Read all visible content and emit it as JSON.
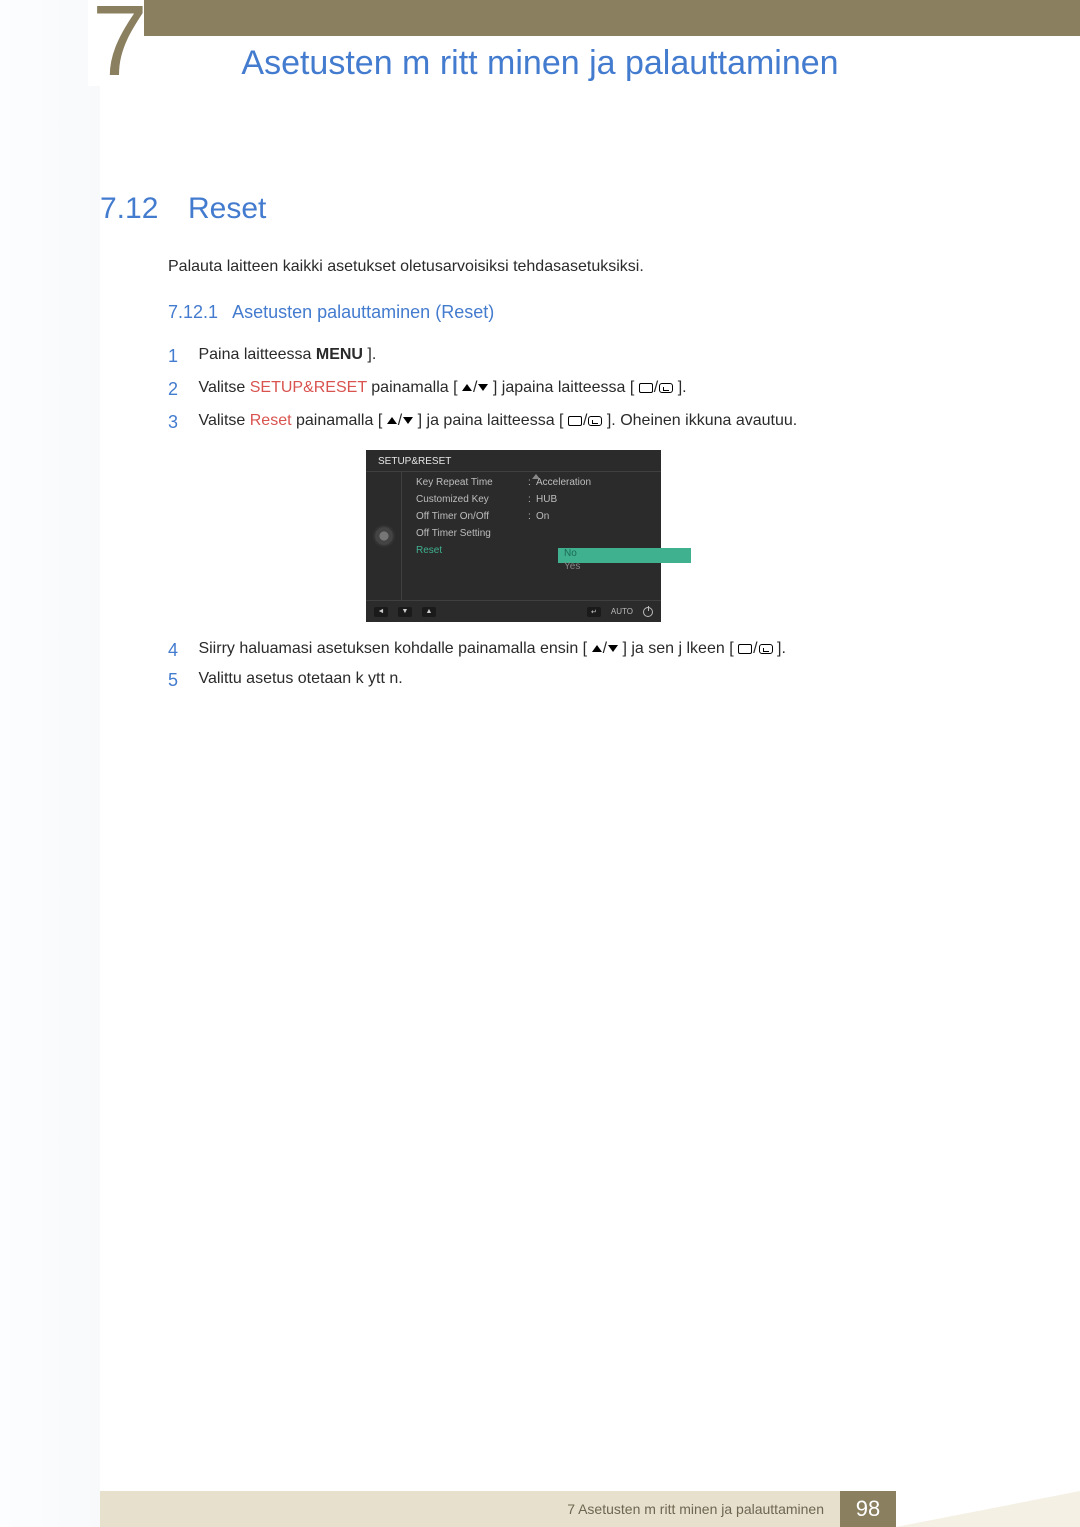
{
  "header": {
    "chapter": "7",
    "title": "Asetusten m  ritt minen ja palauttaminen"
  },
  "section": {
    "num": "7.12",
    "title": "Reset"
  },
  "intro": "Palauta laitteen kaikki asetukset oletusarvoisiksi tehdasasetuksiksi.",
  "subsection": {
    "num": "7.12.1",
    "title": "Asetusten palauttaminen (Reset)"
  },
  "steps": {
    "s1": {
      "num": "1",
      "a": "Paina laitteessa ",
      "menu": "MENU",
      "b": " ]."
    },
    "s2": {
      "num": "2",
      "a": "Valitse ",
      "hl": "SETUP&RESET",
      "b": " painamalla [",
      "c": " ] japaina laitteessa [",
      "d": " ]."
    },
    "s3": {
      "num": "3",
      "a": "Valitse ",
      "hl": "Reset",
      "b": " painamalla [",
      "c": " ] ja paina laitteessa [",
      "d": " ]. Oheinen ikkuna avautuu."
    },
    "s4": {
      "num": "4",
      "a": "Siirry haluamasi asetuksen kohdalle painamalla ensin [",
      "b": " ] ja sen j lkeen [",
      "c": " ]."
    },
    "s5": {
      "num": "5",
      "a": "Valittu asetus otetaan k ytt  n."
    }
  },
  "osd": {
    "title": "SETUP&RESET",
    "rows": [
      {
        "label": "Key Repeat Time",
        "value": "Acceleration"
      },
      {
        "label": "Customized Key",
        "value": "HUB"
      },
      {
        "label": "Off Timer On/Off",
        "value": "On"
      },
      {
        "label": "Off Timer Setting",
        "value": ""
      },
      {
        "label": "Reset",
        "value": ""
      }
    ],
    "options": {
      "no": "No",
      "yes": "Yes"
    },
    "auto": "AUTO"
  },
  "footer": {
    "text": "7 Asetusten m  ritt minen ja palauttaminen",
    "page": "98"
  }
}
